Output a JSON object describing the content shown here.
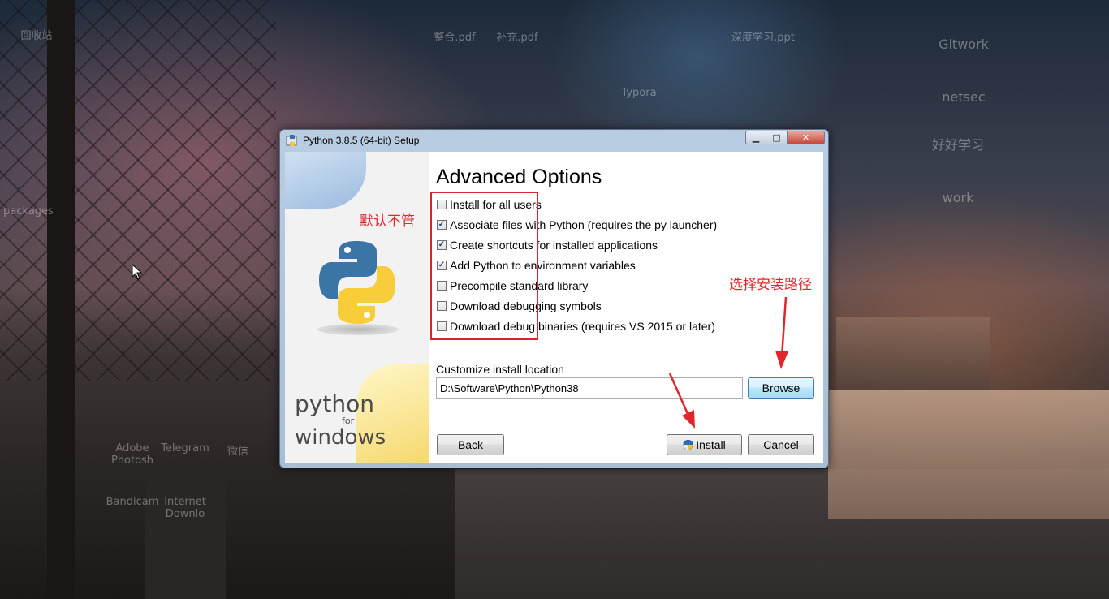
{
  "desktop": {
    "icons": [
      "回收站",
      "整合.pdf",
      "补充.pdf",
      "深度学习.ppt",
      "Typora",
      "Gitwork",
      "netsec",
      "好好学习",
      "work",
      "packages",
      "Adobe Photosh",
      "Telegram",
      "微信",
      "Bandicam",
      "Internet Downlo"
    ]
  },
  "window": {
    "title": "Python 3.8.5 (64-bit) Setup",
    "close_glyph": "✕",
    "maximize_glyph": "□",
    "minimize_glyph": "▁"
  },
  "sidebar": {
    "brand_line1": "python",
    "brand_line2": "for",
    "brand_line3": "windows"
  },
  "page": {
    "heading": "Advanced Options",
    "options": [
      {
        "label": "Install for all users",
        "checked": false
      },
      {
        "label": "Associate files with Python (requires the py launcher)",
        "checked": true
      },
      {
        "label": "Create shortcuts for installed applications",
        "checked": true
      },
      {
        "label": "Add Python to environment variables",
        "checked": true
      },
      {
        "label": "Precompile standard library",
        "checked": false
      },
      {
        "label": "Download debugging symbols",
        "checked": false
      },
      {
        "label": "Download debug binaries (requires VS 2015 or later)",
        "checked": false
      }
    ],
    "location_label": "Customize install location",
    "location_value": "D:\\Software\\Python\\Python38",
    "browse_label": "Browse",
    "back_label": "Back",
    "install_label": "Install",
    "cancel_label": "Cancel"
  },
  "annotations": {
    "default_note": "默认不管",
    "path_note": "选择安装路径",
    "color": "#e0262b"
  }
}
